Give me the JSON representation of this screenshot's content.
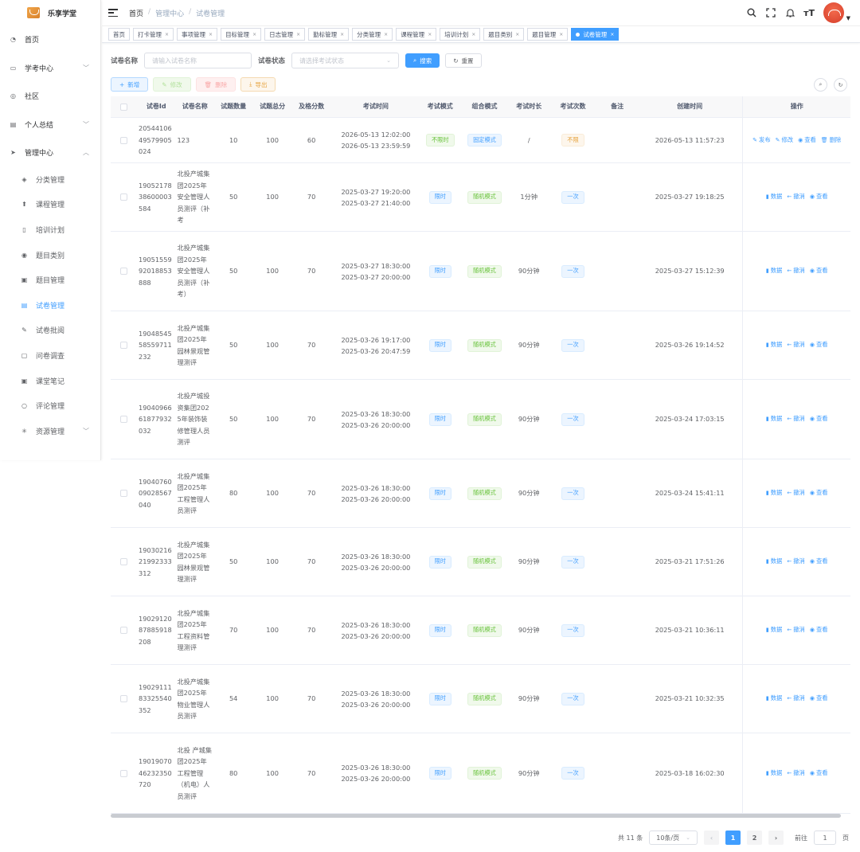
{
  "app": {
    "name": "乐享学堂"
  },
  "sidebar": {
    "items": [
      {
        "label": "首页",
        "icon": "dashboard-icon"
      },
      {
        "label": "学考中心",
        "icon": "monitor-icon",
        "expandable": true
      },
      {
        "label": "社区",
        "icon": "community-icon"
      },
      {
        "label": "个人总结",
        "icon": "document-icon",
        "expandable": true
      },
      {
        "label": "管理中心",
        "icon": "send-icon",
        "expandable": true,
        "expanded": true
      }
    ],
    "sub_items": [
      {
        "label": "分类管理",
        "icon": "layers-icon"
      },
      {
        "label": "课程管理",
        "icon": "course-icon"
      },
      {
        "label": "培训计划",
        "icon": "plan-icon"
      },
      {
        "label": "题目类别",
        "icon": "category-icon"
      },
      {
        "label": "题目管理",
        "icon": "question-icon"
      },
      {
        "label": "试卷管理",
        "icon": "paper-icon",
        "active": true
      },
      {
        "label": "试卷批阅",
        "icon": "review-icon"
      },
      {
        "label": "问卷调查",
        "icon": "survey-icon"
      },
      {
        "label": "课堂笔记",
        "icon": "note-icon"
      },
      {
        "label": "评论管理",
        "icon": "comment-icon"
      },
      {
        "label": "资源管理",
        "icon": "resource-icon",
        "expandable": true
      }
    ]
  },
  "breadcrumb": {
    "home": "首页",
    "parent": "管理中心",
    "current": "试卷管理"
  },
  "tags": [
    "首页",
    "打卡管理",
    "事项管理",
    "目标管理",
    "日志管理",
    "勤标管理",
    "分类管理",
    "课程管理",
    "培训计划",
    "题目类别",
    "题目管理",
    "试卷管理"
  ],
  "search": {
    "name_label": "试卷名称",
    "name_placeholder": "请输入试卷名称",
    "status_label": "试卷状态",
    "status_placeholder": "请选择考试状态",
    "search_btn": "搜索",
    "reset_btn": "重置"
  },
  "toolbar": {
    "add": "新增",
    "edit": "修改",
    "delete": "删除",
    "export": "导出"
  },
  "table": {
    "headers": {
      "id": "试卷Id",
      "name": "试卷名称",
      "count": "试题数量",
      "score": "试题总分",
      "pass": "及格分数",
      "time": "考试时间",
      "mode": "考试模式",
      "combo": "组合模式",
      "duration": "考试时长",
      "times": "考试次数",
      "remark": "备注",
      "created": "创建时间",
      "ops": "操作"
    },
    "rows": [
      {
        "id": "2054410649579905024",
        "name": "123",
        "count": "10",
        "score": "100",
        "pass": "60",
        "start": "2026-05-13 12:02:00",
        "end": "2026-05-13 23:59:59",
        "mode": "不限时",
        "combo": "固定模式",
        "duration": "/",
        "times": "不限",
        "remark": "",
        "created": "2026-05-13 11:57:23",
        "ops": [
          "发布",
          "修改",
          "查看",
          "删除"
        ]
      },
      {
        "id": "1905217838600003584",
        "name": "北投产城集团2025年安全管理人员测评（补考",
        "count": "50",
        "score": "100",
        "pass": "70",
        "start": "2025-03-27 19:20:00",
        "end": "2025-03-27 21:40:00",
        "mode": "限时",
        "combo": "随机模式",
        "duration": "1分钟",
        "times": "一次",
        "remark": "",
        "created": "2025-03-27 19:18:25",
        "ops": [
          "数据",
          "撤消",
          "查看"
        ]
      },
      {
        "id": "1905155992018853888",
        "name": "北投产城集团2025年安全管理人员测评（补考）",
        "count": "50",
        "score": "100",
        "pass": "70",
        "start": "2025-03-27 18:30:00",
        "end": "2025-03-27 20:00:00",
        "mode": "限时",
        "combo": "随机模式",
        "duration": "90分钟",
        "times": "一次",
        "remark": "",
        "created": "2025-03-27 15:12:39",
        "ops": [
          "数据",
          "撤消",
          "查看"
        ]
      },
      {
        "id": "1904854558559711232",
        "name": "北投产城集团2025年园林景观管理测评",
        "count": "50",
        "score": "100",
        "pass": "70",
        "start": "2025-03-26 19:17:00",
        "end": "2025-03-26 20:47:59",
        "mode": "限时",
        "combo": "随机模式",
        "duration": "90分钟",
        "times": "一次",
        "remark": "",
        "created": "2025-03-26 19:14:52",
        "ops": [
          "数据",
          "撤消",
          "查看"
        ]
      },
      {
        "id": "1904096661877932032",
        "name": "北投产城投资集团2025年装饰装修管理人员测评",
        "count": "50",
        "score": "100",
        "pass": "70",
        "start": "2025-03-26 18:30:00",
        "end": "2025-03-26 20:00:00",
        "mode": "限时",
        "combo": "随机模式",
        "duration": "90分钟",
        "times": "一次",
        "remark": "",
        "created": "2025-03-24 17:03:15",
        "ops": [
          "数据",
          "撤消",
          "查看"
        ]
      },
      {
        "id": "1904076009028567040",
        "name": "北投产城集团2025年工程管理人员测评",
        "count": "80",
        "score": "100",
        "pass": "70",
        "start": "2025-03-26 18:30:00",
        "end": "2025-03-26 20:00:00",
        "mode": "限时",
        "combo": "随机模式",
        "duration": "90分钟",
        "times": "一次",
        "remark": "",
        "created": "2025-03-24 15:41:11",
        "ops": [
          "数据",
          "撤消",
          "查看"
        ]
      },
      {
        "id": "1903021621992333312",
        "name": "北投产城集团2025年园林景观管理测评",
        "count": "50",
        "score": "100",
        "pass": "70",
        "start": "2025-03-26 18:30:00",
        "end": "2025-03-26 20:00:00",
        "mode": "限时",
        "combo": "随机模式",
        "duration": "90分钟",
        "times": "一次",
        "remark": "",
        "created": "2025-03-21 17:51:26",
        "ops": [
          "数据",
          "撤消",
          "查看"
        ]
      },
      {
        "id": "1902912087885918208",
        "name": "北投产城集团2025年工程资料管理测评",
        "count": "70",
        "score": "100",
        "pass": "70",
        "start": "2025-03-26 18:30:00",
        "end": "2025-03-26 20:00:00",
        "mode": "限时",
        "combo": "随机模式",
        "duration": "90分钟",
        "times": "一次",
        "remark": "",
        "created": "2025-03-21 10:36:11",
        "ops": [
          "数据",
          "撤消",
          "查看"
        ]
      },
      {
        "id": "1902911183325540352",
        "name": "北投产城集团2025年物业管理人员测评",
        "count": "54",
        "score": "100",
        "pass": "70",
        "start": "2025-03-26 18:30:00",
        "end": "2025-03-26 20:00:00",
        "mode": "限时",
        "combo": "随机模式",
        "duration": "90分钟",
        "times": "一次",
        "remark": "",
        "created": "2025-03-21 10:32:35",
        "ops": [
          "数据",
          "撤消",
          "查看"
        ]
      },
      {
        "id": "1901907046232350720",
        "name": "北投 产城集团2025年工程管理（机电）人员测评",
        "count": "80",
        "score": "100",
        "pass": "70",
        "start": "2025-03-26 18:30:00",
        "end": "2025-03-26 20:00:00",
        "mode": "限时",
        "combo": "随机模式",
        "duration": "90分钟",
        "times": "一次",
        "remark": "",
        "created": "2025-03-18 16:02:30",
        "ops": [
          "数据",
          "撤消",
          "查看"
        ]
      }
    ]
  },
  "pagination": {
    "total": "共 11 条",
    "page_size": "10条/页",
    "pages": [
      "1",
      "2"
    ],
    "current": "1",
    "goto_label": "前往",
    "goto_value": "1",
    "page_unit": "页"
  },
  "colors": {
    "primary": "#409eff",
    "success": "#67c23a",
    "warning": "#e6a23c",
    "danger": "#f56c6c"
  }
}
